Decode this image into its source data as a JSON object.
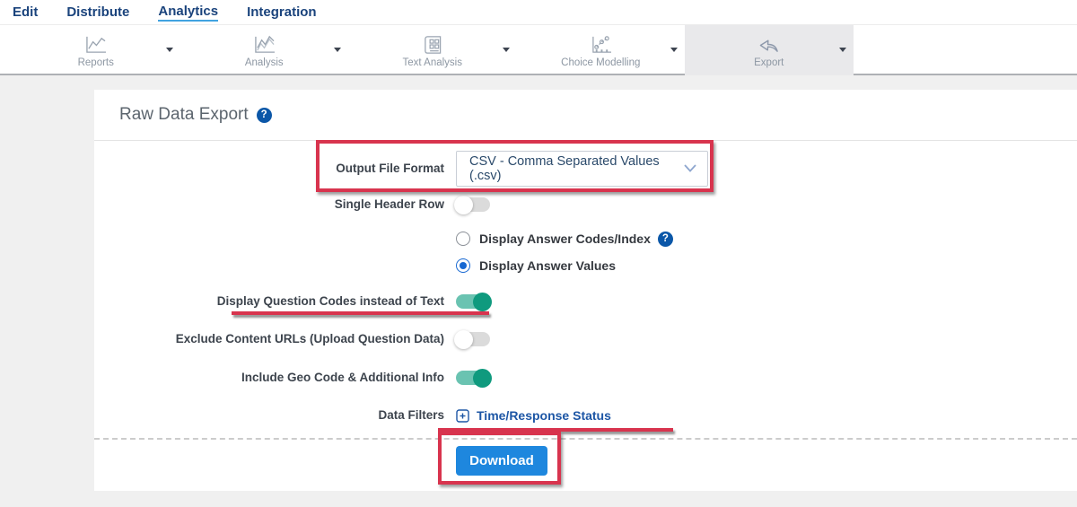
{
  "nav": {
    "items": [
      {
        "label": "Edit",
        "active": false
      },
      {
        "label": "Distribute",
        "active": false
      },
      {
        "label": "Analytics",
        "active": true
      },
      {
        "label": "Integration",
        "active": false
      }
    ]
  },
  "toolbar": {
    "items": [
      {
        "label": "Reports",
        "icon": "reports-chart-icon",
        "active": false
      },
      {
        "label": "Analysis",
        "icon": "analysis-chart-icon",
        "active": false
      },
      {
        "label": "Text Analysis",
        "icon": "text-analysis-icon",
        "active": false
      },
      {
        "label": "Choice Modelling",
        "icon": "choice-modelling-icon",
        "active": false
      },
      {
        "label": "Export",
        "icon": "export-arrow-icon",
        "active": true
      }
    ]
  },
  "page": {
    "title": "Raw Data Export",
    "form": {
      "output_format": {
        "label": "Output File Format",
        "value": "CSV - Comma Separated Values (.csv)"
      },
      "single_header": {
        "label": "Single Header Row",
        "state": "off"
      },
      "radios": [
        {
          "label": "Display Answer Codes/Index",
          "selected": false,
          "has_help": true
        },
        {
          "label": "Display Answer Values",
          "selected": true,
          "has_help": false
        }
      ],
      "question_codes": {
        "label": "Display Question Codes instead of Text",
        "state": "on"
      },
      "exclude_urls": {
        "label": "Exclude Content URLs (Upload Question Data)",
        "state": "off"
      },
      "geo_code": {
        "label": "Include Geo Code & Additional Info",
        "state": "on"
      },
      "data_filters": {
        "label": "Data Filters",
        "link": "Time/Response Status"
      },
      "download": {
        "label": "Download"
      }
    }
  },
  "icons": {
    "help_glyph": "?"
  },
  "colors": {
    "annotation_red": "#d8344e",
    "toggle_on_teal": "#0f9a7e",
    "download_blue": "#1e87de",
    "link_blue": "#1d56a5",
    "nav_navy": "#1a437c",
    "active_tab_gray": "#e9e9eb"
  }
}
